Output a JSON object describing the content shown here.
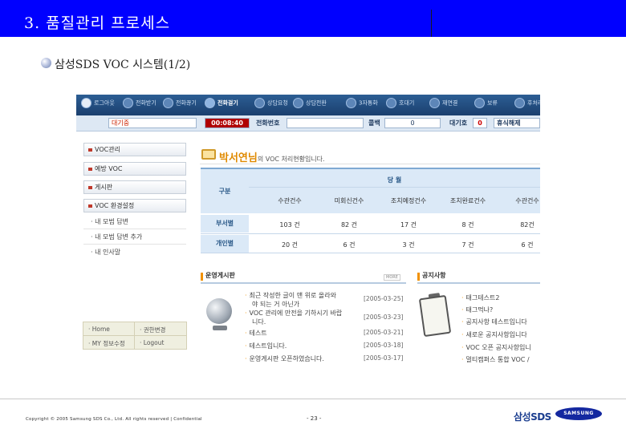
{
  "slide": {
    "title": "3. 품질관리 프로세스",
    "subtitle": "삼성SDS VOC 시스템(1/2)",
    "footer": {
      "copyright": "Copyright © 2005 Samsung SDS Co., Ltd. All rights reserved  |  Confidential",
      "page": "- 23 -",
      "logo_sds": "삼성SDS",
      "logo_samsung": "SAMSUNG"
    }
  },
  "colors": {
    "header_bg": "#0000ff",
    "toolbar_bg": "#1b3f6e",
    "accent_orange": "#f29100",
    "table_header_bg": "#dbe9f7",
    "timer_bg": "#b00000"
  },
  "toolbar": {
    "items": [
      {
        "label": "로그아웃",
        "icon": "logout-icon"
      },
      {
        "label": "전화받기",
        "icon": "phone-receive-icon"
      },
      {
        "label": "전화끊기",
        "icon": "phone-hangup-icon"
      },
      {
        "label": "전화걸기",
        "icon": "phone-dial-icon"
      },
      {
        "label": "상담요청",
        "icon": "consult-request-icon"
      },
      {
        "label": "상담전환",
        "icon": "consult-transfer-icon"
      },
      {
        "label": "3자통화",
        "icon": "three-way-call-icon"
      },
      {
        "label": "호대기",
        "icon": "hold-icon"
      },
      {
        "label": "재연결",
        "icon": "reconnect-icon"
      },
      {
        "label": "보류",
        "icon": "pause-icon"
      },
      {
        "label": "후처리",
        "icon": "after-work-icon"
      }
    ]
  },
  "statusbar": {
    "state": "대기중",
    "timer": "00:08:40",
    "phone_label": "전화번호",
    "queue_label": "콜백",
    "queue_value": "0",
    "waiting_label": "대기호",
    "waiting_value": "0",
    "rest_button": "휴식해제"
  },
  "sidebar": {
    "menus": [
      "VOC관리",
      "예방 VOC",
      "게시판",
      "VOC 환경설정"
    ],
    "sub_items": [
      "· 내 모범 답변",
      "· 내 모범 답변 추가",
      "· 내 인사말"
    ],
    "login": {
      "home": "· Home",
      "permission": "· 권한변경",
      "my_info": "· MY 정보수정",
      "logout": "· Logout"
    }
  },
  "main": {
    "greeting_name": "박서연님",
    "greeting_text": "의 VOC 처리현황입니다.",
    "stats": {
      "group_header": "당 월",
      "row_header_title": "구분",
      "columns": [
        "수관건수",
        "미회신건수",
        "조치예정건수",
        "조치완료건수",
        "수관건수"
      ],
      "rows": [
        {
          "label": "부서별",
          "values": [
            "103 건",
            "82 건",
            "17 건",
            "8 건",
            "82건"
          ]
        },
        {
          "label": "개인별",
          "values": [
            "20 건",
            "6 건",
            "3 건",
            "7 건",
            "6 건"
          ]
        }
      ]
    },
    "board": {
      "title": "운영게시판",
      "more": "MORE",
      "items": [
        {
          "text": "최근 작성한 글이 맨 위로 올라와",
          "date": "[2005-03-25]"
        },
        {
          "text": "야 되는 거 아닌가",
          "date": ""
        },
        {
          "text": "VOC 관리에 만전을 기하시기 바랍",
          "date": "[2005-03-23]"
        },
        {
          "text": "니다.",
          "date": ""
        },
        {
          "text": "테스트",
          "date": "[2005-03-21]"
        },
        {
          "text": "테스트입니다.",
          "date": "[2005-03-18]"
        },
        {
          "text": "운영게시판 오픈하였습니다.",
          "date": "[2005-03-17]"
        }
      ]
    },
    "notice": {
      "title": "공지사항",
      "items": [
        "태그테스트2",
        "태그먹나?",
        "공지사항 테스트입니다",
        "새로운 공지사항입니다",
        "VOC 오픈 공지사항입니",
        "멀티캠퍼스 통합 VOC /"
      ]
    }
  }
}
